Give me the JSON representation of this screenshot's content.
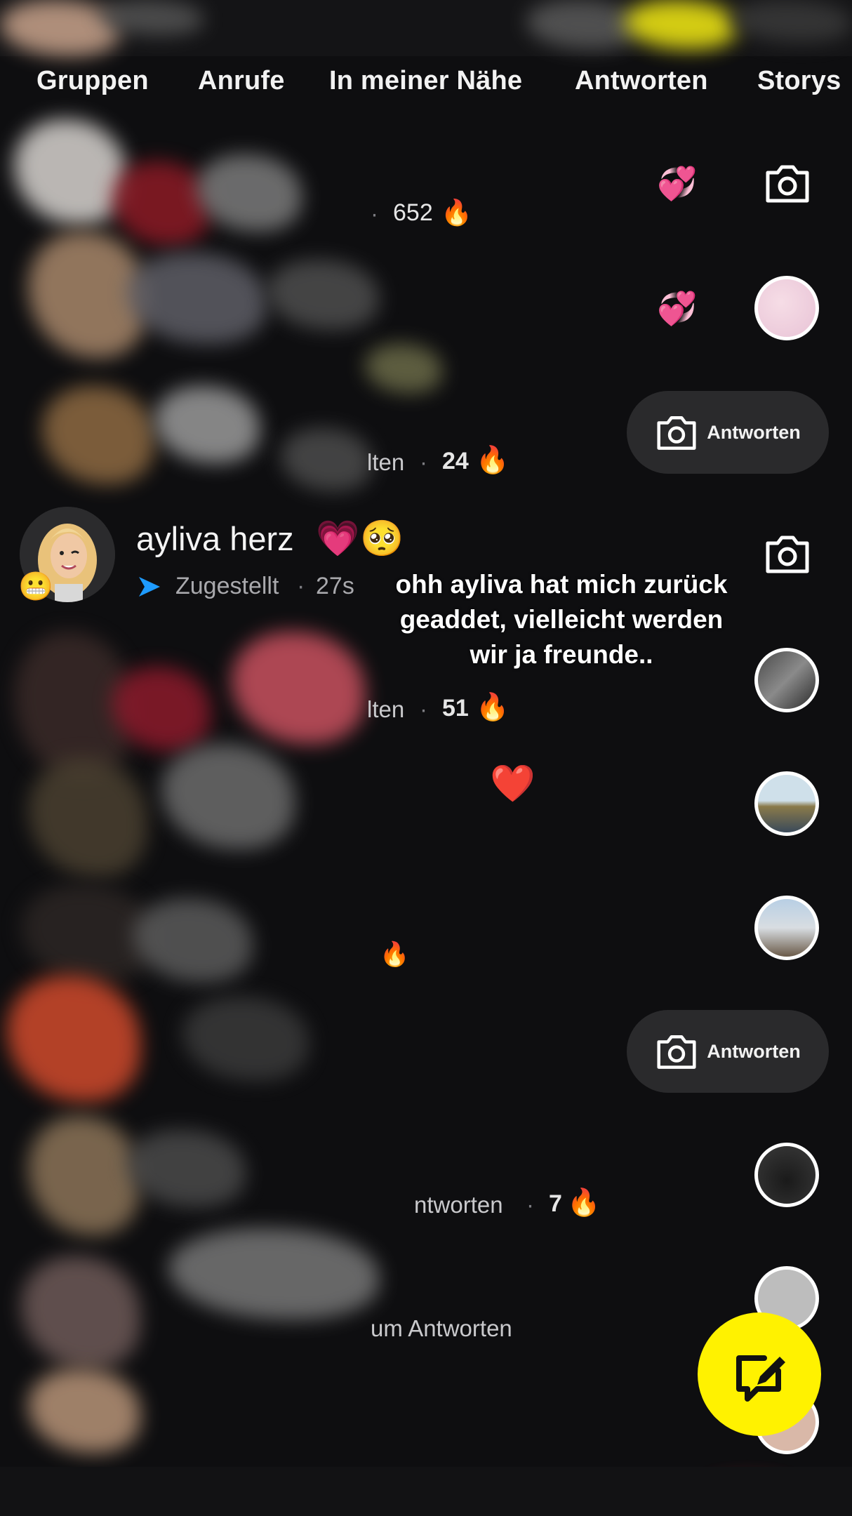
{
  "tabs": [
    "Gruppen",
    "Anrufe",
    "In meiner Nähe",
    "Antworten",
    "Storys"
  ],
  "rows": [
    {
      "streak": "652",
      "streak_sep": "·"
    },
    {},
    {
      "status_fragment": "lten",
      "streak": "24",
      "streak_sep": "·",
      "reply_label": "Antworten"
    },
    {
      "title": "ayliva herz",
      "status": "Zugestellt",
      "time": "27s",
      "sep": "·"
    },
    {
      "status_fragment": "lten",
      "streak": "51",
      "streak_sep": "·"
    },
    {},
    {},
    {
      "reply_label": "Antworten"
    },
    {
      "status_fragment": "ntworten",
      "streak": "7",
      "streak_sep": "·"
    },
    {
      "status_fragment": "um Antworten"
    }
  ],
  "caption": "ohh ayliva hat mich zurück geaddet, vielleicht werden wir ja freunde..",
  "colors": {
    "background": "#0e0e10",
    "accent_yellow": "#fff200",
    "delivered_blue": "#1e9bff",
    "pill": "#2a2a2c"
  },
  "icons": [
    "camera-icon",
    "sparkling-hearts-icon",
    "fire-icon",
    "chat-new-icon",
    "sent-arrow-icon"
  ]
}
